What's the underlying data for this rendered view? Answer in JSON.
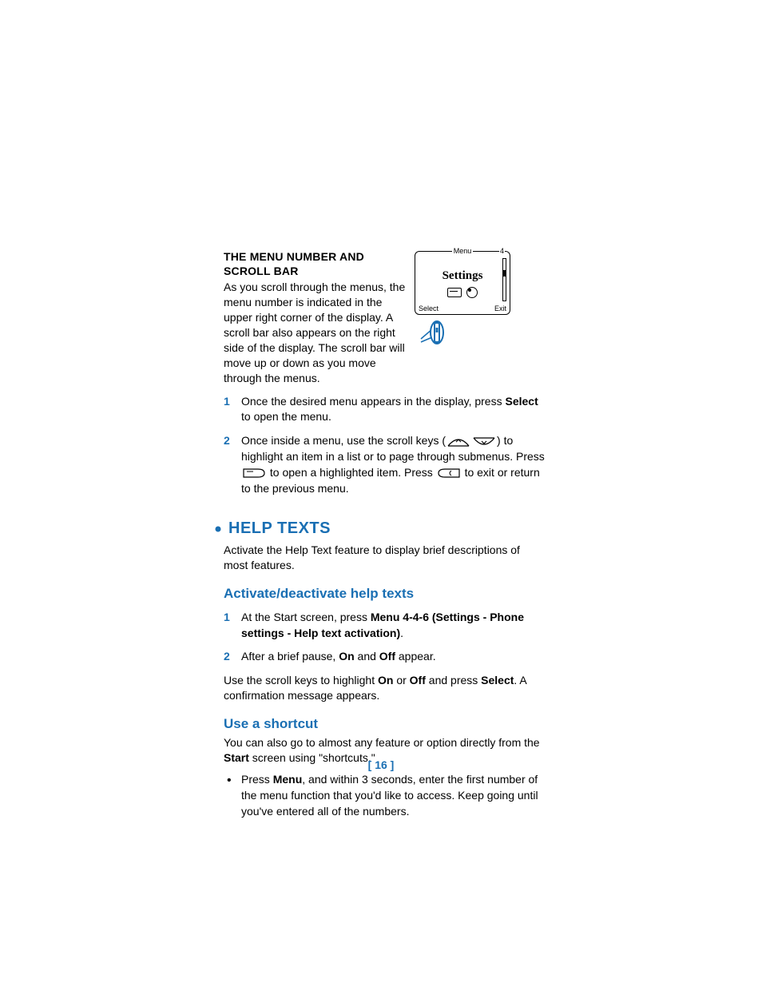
{
  "section1": {
    "subhead": "THE MENU NUMBER AND SCROLL BAR",
    "paragraph": "As you scroll through the menus, the menu number is indicated in the upper right corner of the display. A scroll bar also appears on the right side of the display. The scroll bar will move up or down as you move through the menus."
  },
  "figure": {
    "menu_label": "Menu",
    "menu_number": "4",
    "center_text": "Settings",
    "softkey_left": "Select",
    "softkey_right": "Exit"
  },
  "step1": {
    "num": "1",
    "pre": "Once the desired menu appears in the display, press ",
    "bold": "Select",
    "post": " to open the menu."
  },
  "step2": {
    "num": "2",
    "pre": "Once inside a menu, use the scroll keys (",
    "mid1": ") to highlight an item in a list or to page through submenus. Press ",
    "mid2": " to open a highlighted item. Press ",
    "post": " to exit or return to the previous menu."
  },
  "help_texts": {
    "title": "HELP TEXTS",
    "intro": "Activate the Help Text feature to display brief descriptions of most features.",
    "sub1_title": "Activate/deactivate help texts",
    "s1_step1": {
      "num": "1",
      "pre": "At the Start screen, press ",
      "bold": "Menu 4-4-6 (Settings - Phone settings - Help text activation)",
      "post": "."
    },
    "s1_step2": {
      "num": "2",
      "pre": "After a brief pause, ",
      "b1": "On",
      "mid": " and ",
      "b2": "Off",
      "post": " appear."
    },
    "confirm_pre": "Use the scroll keys to highlight ",
    "confirm_b1": "On",
    "confirm_mid1": " or ",
    "confirm_b2": "Off",
    "confirm_mid2": " and press ",
    "confirm_b3": "Select",
    "confirm_post": ". A confirmation message appears.",
    "sub2_title": "Use a shortcut",
    "shortcut_pre": "You can also go to almost any feature or option directly from the ",
    "shortcut_b": "Start",
    "shortcut_post": " screen using \"shortcuts.\"",
    "bullet1_pre": "Press ",
    "bullet1_b": "Menu",
    "bullet1_post": ", and within 3 seconds, enter the first number of the menu function that you'd like to access. Keep going until you've entered all of the numbers."
  },
  "page_number": "[ 16 ]"
}
